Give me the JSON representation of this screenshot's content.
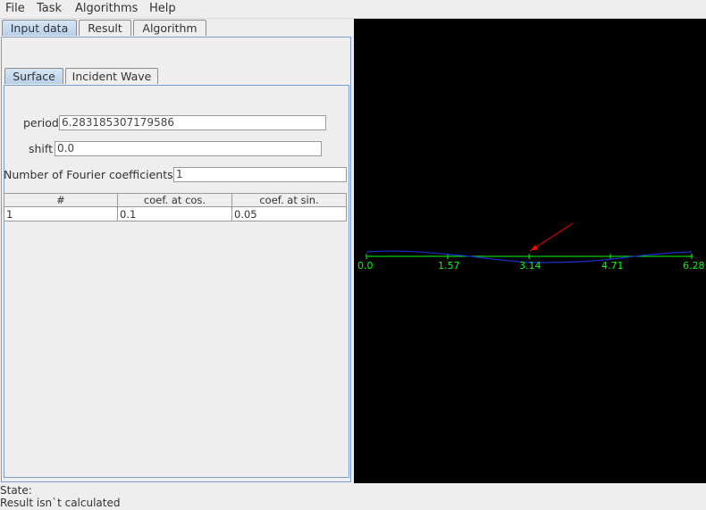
{
  "menubar": {
    "items": [
      "File",
      "Task",
      "Algorithms",
      "Help"
    ]
  },
  "main_tabs": [
    "Input data",
    "Result",
    "Algorithm"
  ],
  "sub_tabs": [
    "Surface",
    "Incident Wave"
  ],
  "form": {
    "period_label": "period",
    "period_value": "6.283185307179586",
    "shift_label": "shift",
    "shift_value": "0.0",
    "fourier_label": "Number of Fourier coefficients",
    "fourier_value": "1"
  },
  "table": {
    "headers": [
      "#",
      "coef. at cos.",
      "coef. at sin."
    ],
    "rows": [
      [
        "1",
        "0.1",
        "0.05"
      ]
    ]
  },
  "plot": {
    "x_ticks": [
      "0.0",
      "1.57",
      "3.14",
      "4.71",
      "6.28"
    ],
    "axis_color": "#00ff00",
    "curve_color": "#1a2fd0",
    "arrow_color": "#ff0000"
  },
  "status": {
    "state_label": "State:",
    "state_text": "Result isn`t calculated"
  }
}
